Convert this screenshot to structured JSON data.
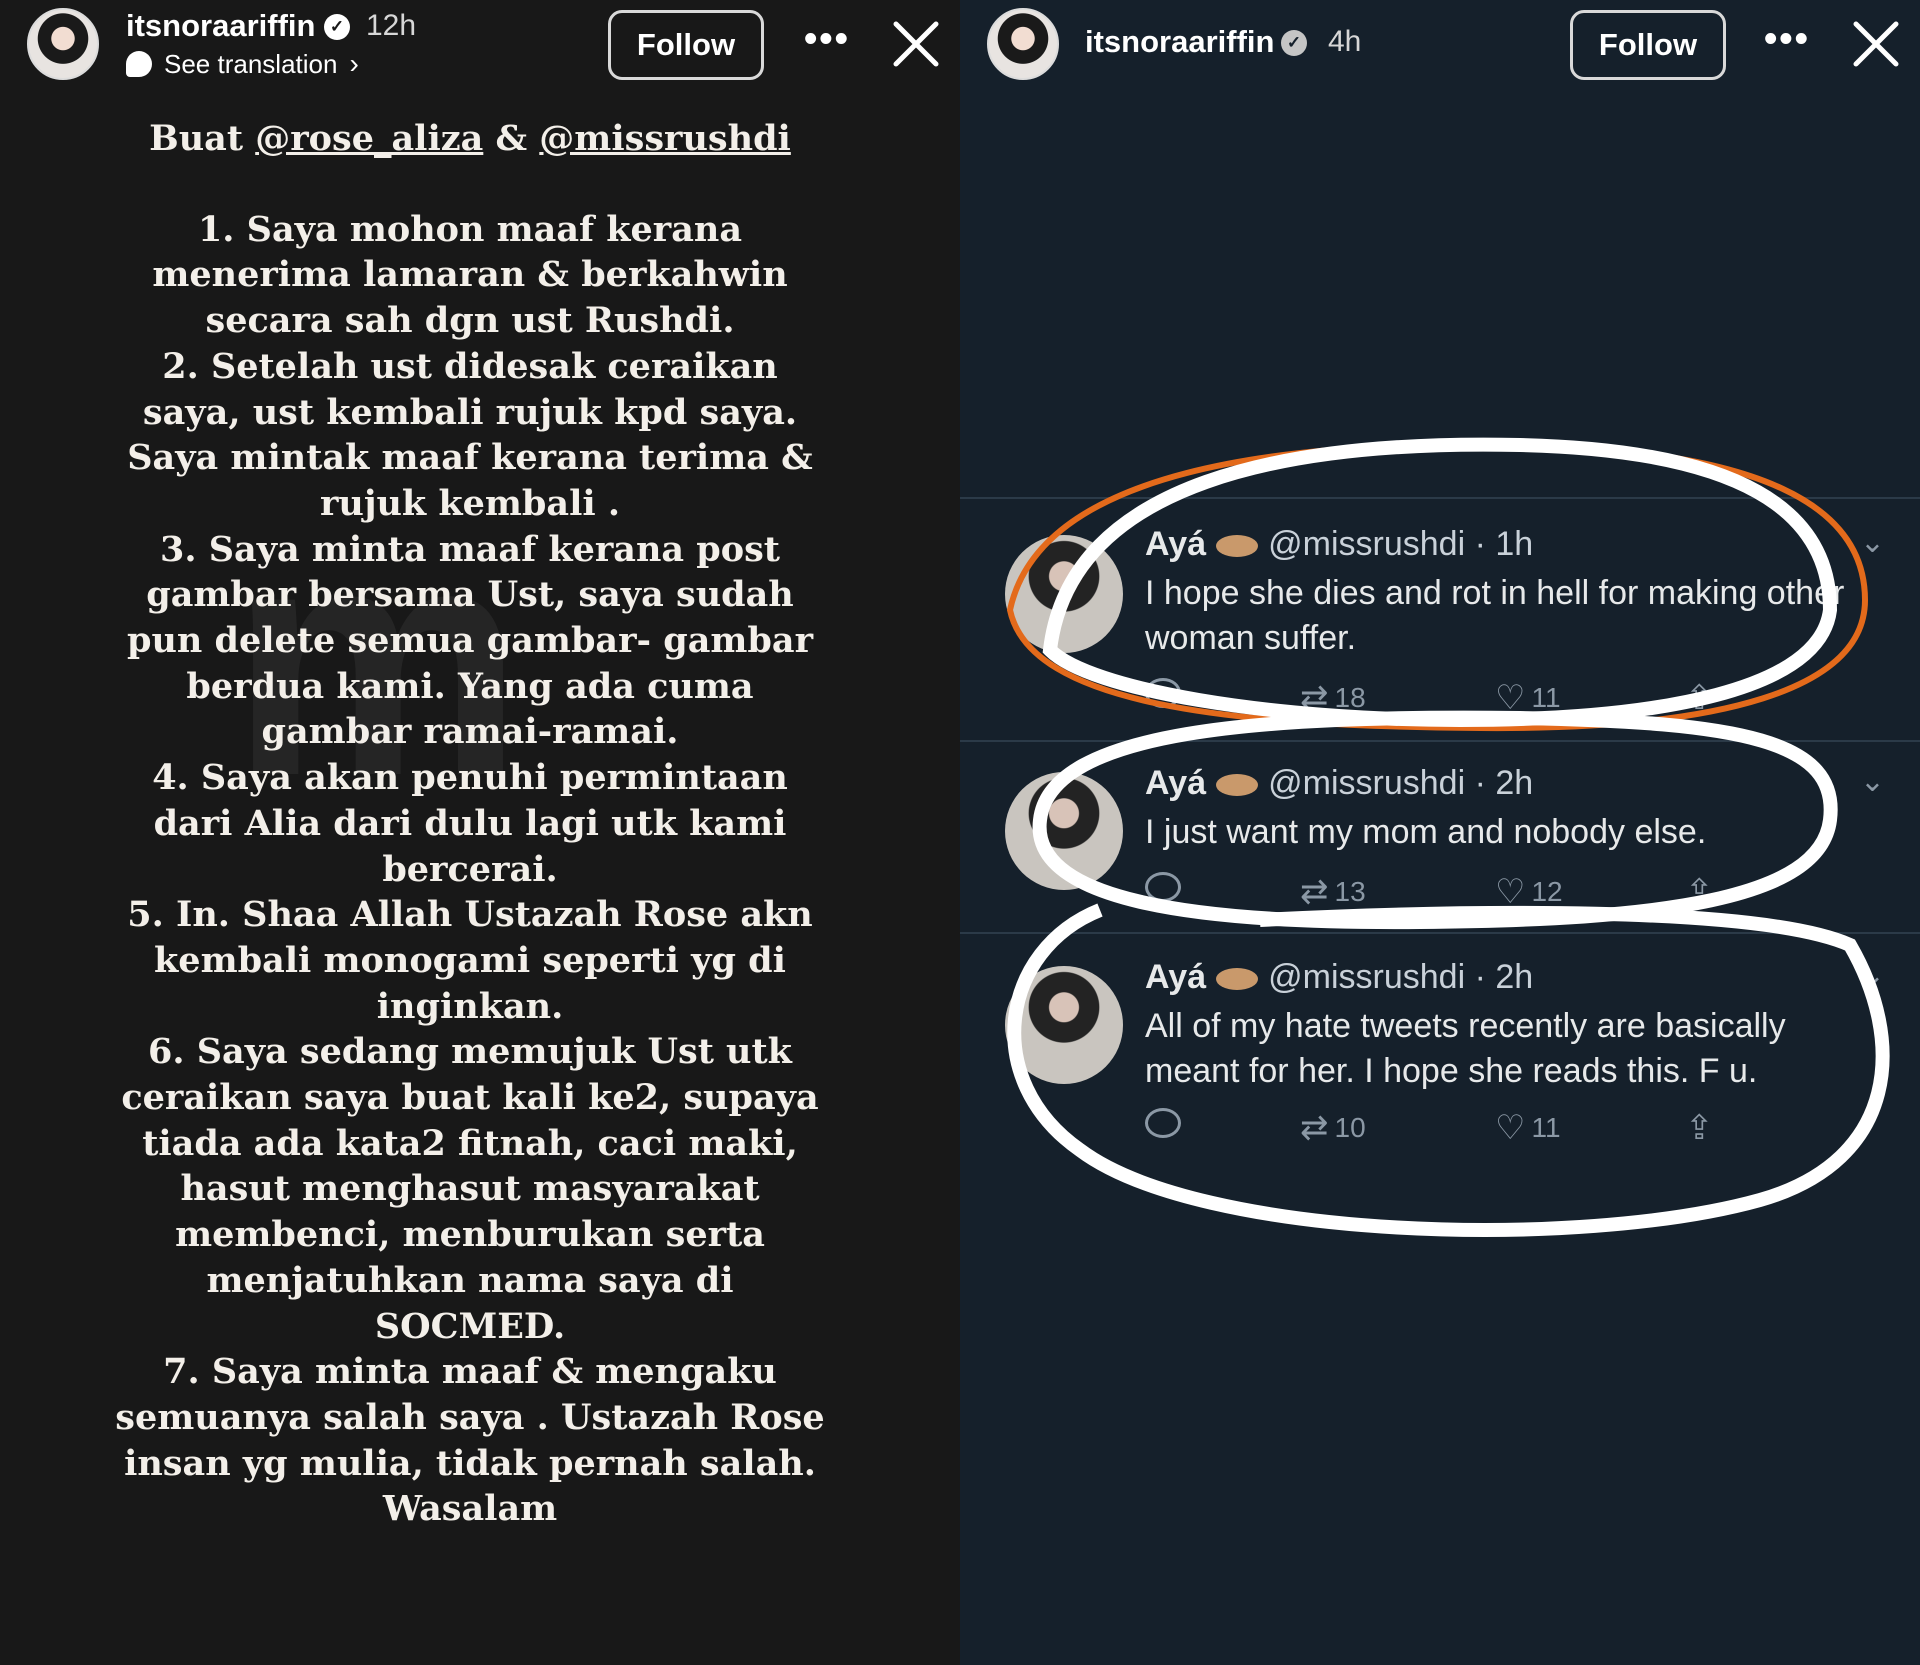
{
  "left": {
    "username": "itsnoraariffin",
    "time": "12h",
    "translation": "See translation",
    "follow": "Follow",
    "heading_prefix": "Buat ",
    "mention1": "@rose_aliza",
    "amp": " & ",
    "mention2": "@missrushdi",
    "lines": [
      "1. Saya mohon maaf kerana\nmenerima lamaran & berkahwin\nsecara sah dgn ust Rushdi.",
      "2. Setelah ust didesak ceraikan\nsaya, ust kembali rujuk kpd saya.\nSaya mintak maaf kerana terima &\nrujuk kembali .",
      "3. Saya minta maaf kerana post\ngambar bersama Ust, saya sudah\npun delete semua gambar- gambar\nberdua kami. Yang ada cuma\ngambar ramai-ramai.",
      "4. Saya akan penuhi permintaan\ndari Alia dari dulu lagi utk kami\nbercerai.",
      "5. In. Shaa Allah Ustazah Rose akn\nkembali monogami seperti yg di\ninginkan.",
      "6. Saya sedang memujuk Ust utk\nceraikan saya buat kali ke2, supaya\ntiada ada kata2 fitnah, caci maki,\nhasut menghasut masyarakat\nmembenci, menburukan serta\nmenjatuhkan nama saya di\nSOCMED.",
      "7. Saya minta maaf &  mengaku\nsemuanya salah saya . Ustazah Rose\ninsan yg mulia, tidak pernah salah.\nWasalam"
    ]
  },
  "right": {
    "username": "itsnoraariffin",
    "time": "4h",
    "follow": "Follow",
    "tweets": [
      {
        "name": "Ayá",
        "handle": "@missrushdi · 1h",
        "text": "I hope she dies and rot in hell for making other woman suffer.",
        "retweets": "18",
        "likes": "11"
      },
      {
        "name": "Ayá",
        "handle": "@missrushdi · 2h",
        "text": "I just want my mom and nobody else.",
        "retweets": "13",
        "likes": "12"
      },
      {
        "name": "Ayá",
        "handle": "@missrushdi · 2h",
        "text": "All of my hate tweets recently are basically meant for her. I hope she reads this. F u.",
        "retweets": "10",
        "likes": "11"
      }
    ]
  }
}
